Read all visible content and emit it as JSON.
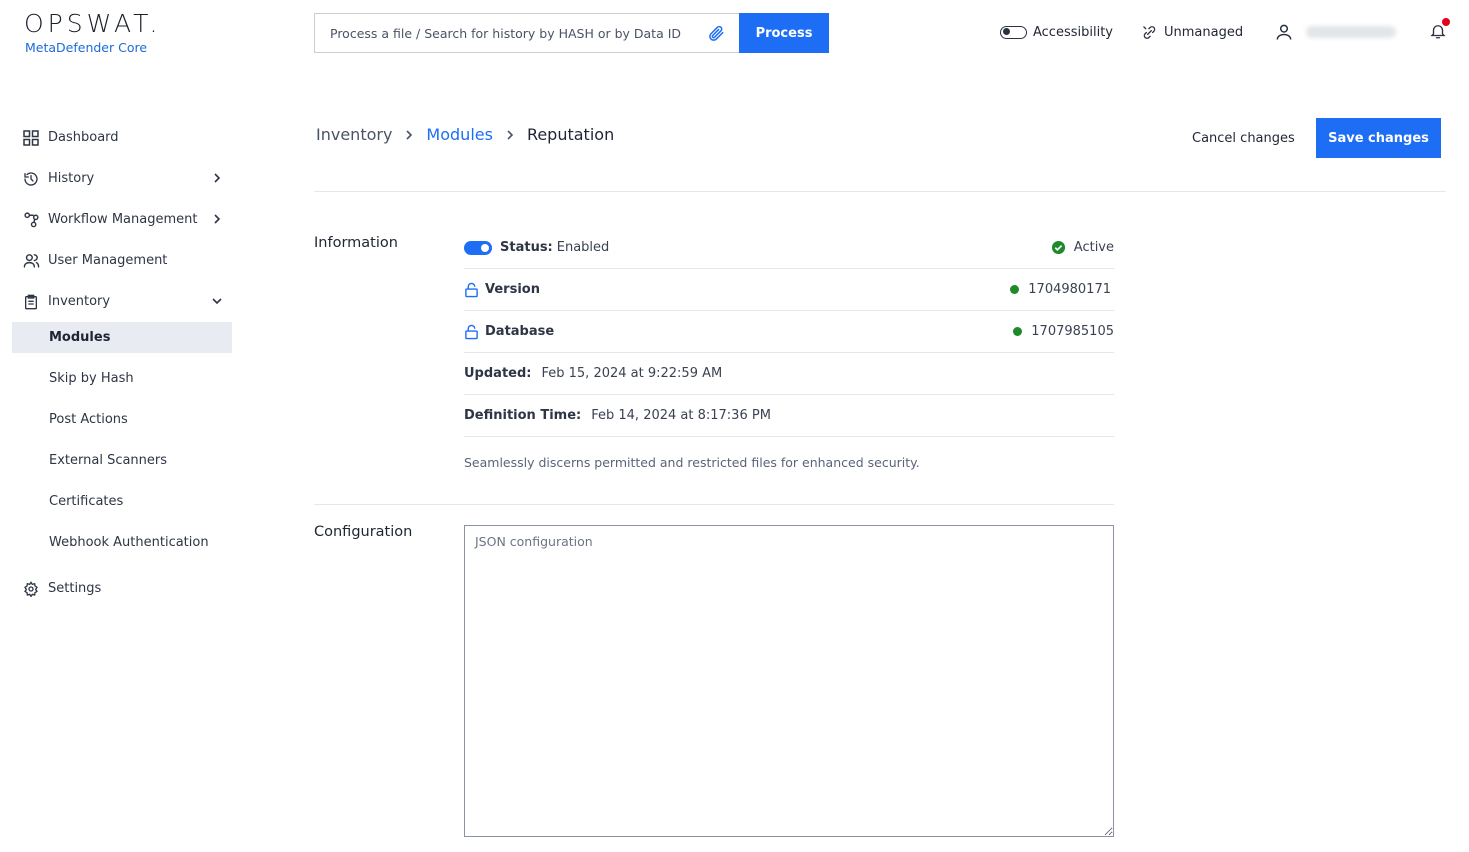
{
  "brand": {
    "name": "OPSWAT.",
    "product": "MetaDefender Core"
  },
  "search": {
    "placeholder": "Process a file / Search for history by HASH or by Data ID",
    "process_label": "Process"
  },
  "header": {
    "accessibility_label": "Accessibility",
    "unmanaged_label": "Unmanaged"
  },
  "sidebar": {
    "items": [
      {
        "label": "Dashboard",
        "icon": "grid-icon"
      },
      {
        "label": "History",
        "icon": "history-icon"
      },
      {
        "label": "Workflow Management",
        "icon": "workflow-icon"
      },
      {
        "label": "User Management",
        "icon": "users-icon"
      },
      {
        "label": "Inventory",
        "icon": "clipboard-icon"
      }
    ],
    "inventory_sub": [
      {
        "label": "Modules"
      },
      {
        "label": "Skip by Hash"
      },
      {
        "label": "Post Actions"
      },
      {
        "label": "External Scanners"
      },
      {
        "label": "Certificates"
      },
      {
        "label": "Webhook Authentication"
      }
    ],
    "settings": {
      "label": "Settings",
      "icon": "gear-icon"
    }
  },
  "breadcrumb": [
    "Inventory",
    "Modules",
    "Reputation"
  ],
  "actions": {
    "cancel": "Cancel changes",
    "save": "Save changes"
  },
  "information": {
    "title": "Information",
    "status_label": "Status:",
    "status_value": "Enabled",
    "active_label": "Active",
    "version_label": "Version",
    "version_value": "1704980171",
    "database_label": "Database",
    "database_value": "1707985105",
    "updated_label": "Updated:",
    "updated_value": "Feb 15, 2024 at 9:22:59 AM",
    "definition_label": "Definition Time:",
    "definition_value": "Feb 14, 2024 at 8:17:36 PM",
    "description": "Seamlessly discerns permitted and restricted files for enhanced security."
  },
  "configuration": {
    "title": "Configuration",
    "placeholder": "JSON configuration"
  },
  "colors": {
    "accent": "#1d6ef5",
    "success": "#1f8a2c",
    "notification": "#e3001b"
  }
}
